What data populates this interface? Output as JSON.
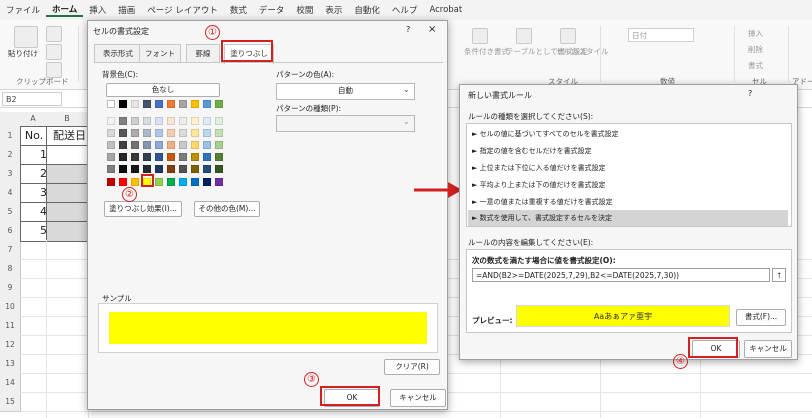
{
  "ribbon": {
    "tabs": [
      "ファイル",
      "ホーム",
      "挿入",
      "描画",
      "ページ レイアウト",
      "数式",
      "データ",
      "校閲",
      "表示",
      "自動化",
      "ヘルプ",
      "Acrobat"
    ],
    "active_tab": "ホーム",
    "paste_label": "貼り付け",
    "clipboard_group": "クリップボード",
    "style_items": [
      "条件付き書式",
      "テーブルとして書式設定",
      "セルのスタイル"
    ],
    "style_group": "スタイル",
    "number_format": "日付",
    "number_group": "数値",
    "cell_items": [
      "挿入",
      "削除",
      "書式"
    ],
    "cell_group": "セル",
    "addin_group": "アドー"
  },
  "sheet": {
    "name_box": "B2",
    "columns": [
      "A",
      "B"
    ],
    "row_headers": [
      "1",
      "2",
      "3",
      "4",
      "5",
      "6",
      "7",
      "8",
      "9",
      "10",
      "11",
      "12",
      "13",
      "14",
      "15"
    ],
    "header_a": "No.",
    "header_b": "配送日",
    "numbers": [
      "1",
      "2",
      "3",
      "4",
      "5"
    ]
  },
  "format_dialog": {
    "title": "セルの書式設定",
    "help": "?",
    "close": "×",
    "tabs": [
      "表示形式",
      "フォント",
      "罫線",
      "塗りつぶし"
    ],
    "active_tab": "塗りつぶし",
    "bg_color_label": "背景色(C):",
    "no_color": "色なし",
    "fill_effects": "塗りつぶし効果(I)...",
    "more_colors": "その他の色(M)...",
    "pattern_color_label": "パターンの色(A):",
    "pattern_color_value": "自動",
    "pattern_type_label": "パターンの種類(P):",
    "pattern_type_value": "",
    "sample_label": "サンプル",
    "sample_color": "#ffff00",
    "clear": "クリア(R)",
    "ok": "OK",
    "cancel": "キャンセル",
    "row_std": [
      "#ffffff",
      "#000000",
      "#e7e6e6",
      "#44546a",
      "#4472c4",
      "#ed7d31",
      "#a5a5a5",
      "#ffc000",
      "#5b9bd5",
      "#70ad47"
    ],
    "theme_rows": [
      [
        "#f2f2f2",
        "#808080",
        "#d0cece",
        "#d6dce4",
        "#d9e1f2",
        "#fce4d6",
        "#ededed",
        "#fff2cc",
        "#ddebf7",
        "#e2efda"
      ],
      [
        "#d9d9d9",
        "#595959",
        "#aeaaaa",
        "#acb9ca",
        "#b4c6e7",
        "#f8cbad",
        "#dbdbdb",
        "#ffe699",
        "#bdd7ee",
        "#c6e0b4"
      ],
      [
        "#bfbfbf",
        "#404040",
        "#757171",
        "#8497b0",
        "#8ea9db",
        "#f4b084",
        "#c9c9c9",
        "#ffd966",
        "#9bc2e6",
        "#a9d08e"
      ],
      [
        "#a6a6a6",
        "#262626",
        "#3a3838",
        "#333f4f",
        "#305496",
        "#c65911",
        "#7b7b7b",
        "#bf8f00",
        "#2f75b5",
        "#548235"
      ],
      [
        "#808080",
        "#0d0d0d",
        "#161616",
        "#222b35",
        "#203764",
        "#833c0b",
        "#525252",
        "#7f6000",
        "#1f4e78",
        "#375623"
      ]
    ],
    "standard_row": [
      "#c00000",
      "#ff0000",
      "#ffc000",
      "#ffff00",
      "#92d050",
      "#00b050",
      "#00b0f0",
      "#0070c0",
      "#002060",
      "#7030a0"
    ]
  },
  "rule_dialog": {
    "title": "新しい書式ルール",
    "help": "?",
    "rule_type_label": "ルールの種類を選択してください(S):",
    "rule_types": [
      "► セルの値に基づいてすべてのセルを書式設定",
      "► 指定の値を含むセルだけを書式設定",
      "► 上位または下位に入る値だけを書式設定",
      "► 平均より上または下の値だけを書式設定",
      "► 一意の値または重複する値だけを書式設定",
      "► 数式を使用して、書式設定するセルを決定"
    ],
    "edit_label": "ルールの内容を編集してください(E):",
    "formula_label": "次の数式を満たす場合に値を書式設定(O):",
    "formula": "=AND(B2>=DATE(2025,7,29),B2<=DATE(2025,7,30))",
    "preview_label": "プレビュー:",
    "preview_text": "Aaあぁアァ亜宇",
    "preview_color": "#ffff00",
    "format_button": "書式(F)...",
    "ok": "OK",
    "cancel": "キャンセル"
  },
  "annotations": [
    "①",
    "②",
    "③",
    "④"
  ],
  "accent_red": "#d32020"
}
